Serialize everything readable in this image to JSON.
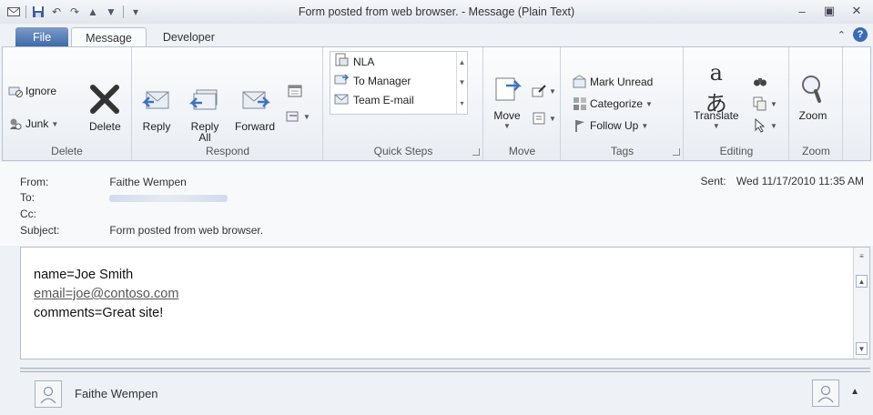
{
  "window": {
    "title": "Form posted from web browser. - Message (Plain Text)"
  },
  "tabs": [
    {
      "label": "File"
    },
    {
      "label": "Message"
    },
    {
      "label": "Developer"
    }
  ],
  "ribbon": {
    "delete_group": {
      "label": "Delete",
      "ignore": "Ignore",
      "junk": "Junk",
      "delete": "Delete"
    },
    "respond_group": {
      "label": "Respond",
      "reply": "Reply",
      "reply_all_1": "Reply",
      "reply_all_2": "All",
      "forward": "Forward"
    },
    "quick_steps_group": {
      "label": "Quick Steps",
      "items": [
        "NLA",
        "To Manager",
        "Team E-mail"
      ]
    },
    "move_group": {
      "label": "Move",
      "move": "Move"
    },
    "tags_group": {
      "label": "Tags",
      "mark_unread": "Mark Unread",
      "categorize": "Categorize",
      "follow_up": "Follow Up"
    },
    "editing_group": {
      "label": "Editing",
      "translate": "Translate"
    },
    "zoom_group": {
      "label": "Zoom",
      "zoom": "Zoom"
    }
  },
  "message": {
    "from_label": "From:",
    "from_value": "Faithe Wempen",
    "to_label": "To:",
    "cc_label": "Cc:",
    "subject_label": "Subject:",
    "subject_value": "Form posted from web browser.",
    "sent_label": "Sent:",
    "sent_value": "Wed 11/17/2010 11:35 AM",
    "body": {
      "line1": "name=Joe Smith",
      "line2": "email=joe@contoso.com",
      "line3": "comments=Great site!"
    }
  },
  "people_pane": {
    "name": "Faithe Wempen"
  },
  "colors": {
    "file_tab": "#3c67a8",
    "accent": "#3b6bb5"
  }
}
